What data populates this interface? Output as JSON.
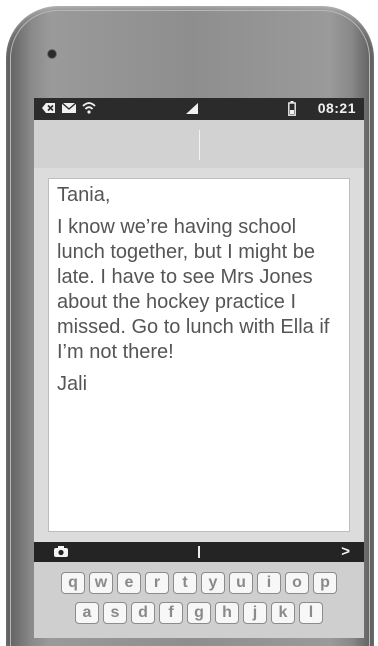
{
  "status_bar": {
    "icons": [
      "notification-x-icon",
      "mail-icon",
      "wifi-icon",
      "signal-icon",
      "battery-icon"
    ],
    "time": "08:21"
  },
  "message": {
    "greeting": "Tania,",
    "body": "I know we’re having school lunch together, but I might be late. I have to see Mrs Jones about the hockey practice I missed. Go to lunch with Ella if I’m not there!",
    "signature": "Jali"
  },
  "toolbar": {
    "icons": [
      "camera-icon",
      "chevron-right-icon"
    ]
  },
  "keyboard": {
    "row1": [
      "q",
      "w",
      "e",
      "r",
      "t",
      "y",
      "u",
      "i",
      "o",
      "p"
    ],
    "row2": [
      "a",
      "s",
      "d",
      "f",
      "g",
      "h",
      "j",
      "k",
      "l"
    ]
  },
  "colors": {
    "phone_body": "#8e8e8e",
    "status_bar": "#2b2b2b",
    "message_text": "#555555"
  }
}
